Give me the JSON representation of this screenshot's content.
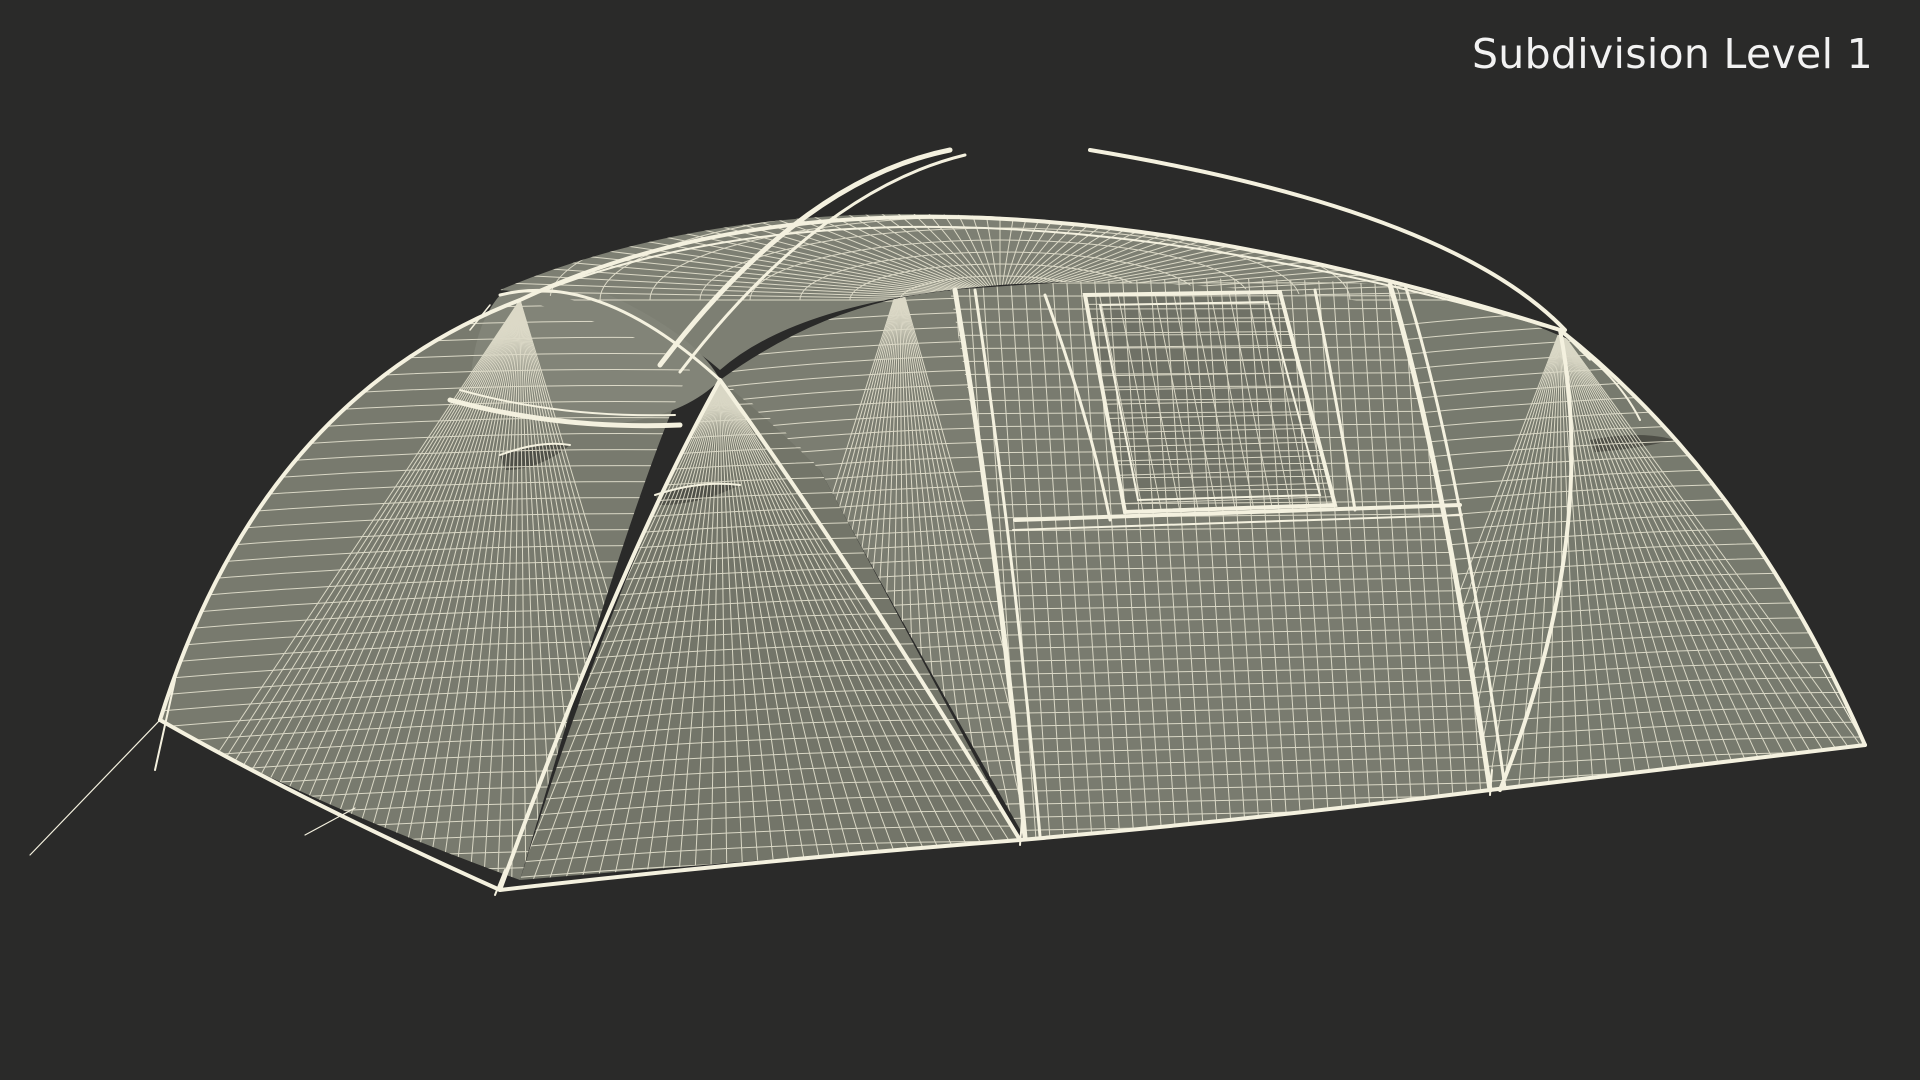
{
  "viewport": {
    "label": "Subdivision Level 1",
    "colors": {
      "background": "#2a2a29",
      "surface": "#7a7a6e",
      "surface_dark": "#66665c",
      "wire": "#ece9d6",
      "seam": "#f4f1df"
    }
  }
}
